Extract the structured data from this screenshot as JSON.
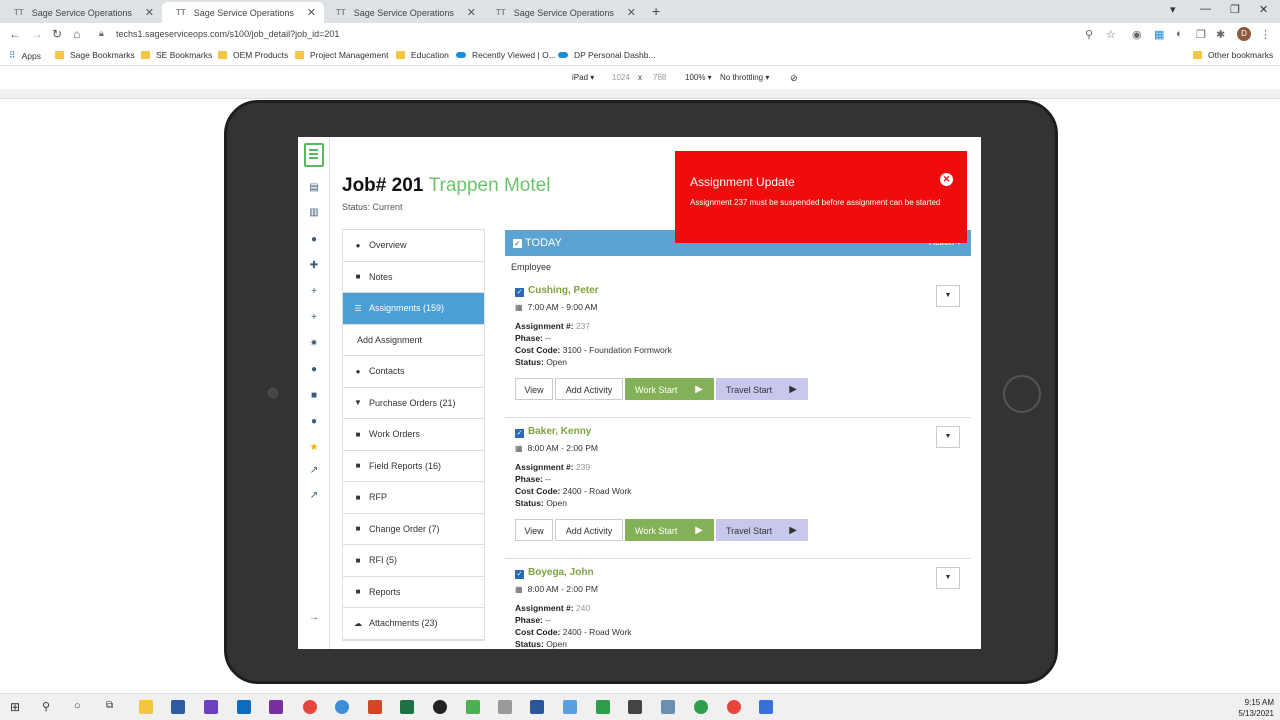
{
  "browser": {
    "tabs": [
      {
        "favicon": "TT",
        "title": "Sage Service Operations"
      },
      {
        "favicon": "TT",
        "title": "Sage Service Operations"
      },
      {
        "favicon": "TT",
        "title": "Sage Service Operations"
      },
      {
        "favicon": "TT",
        "title": "Sage Service Operations"
      }
    ],
    "url": "techs1.sageserviceops.com/s100/job_detail?job_id=201",
    "avatar_letter": "D",
    "bookmarks": [
      "Apps",
      "Sage Bookmarks",
      "SE Bookmarks",
      "OEM Products",
      "Project Management",
      "Education",
      "Recently Viewed | O...",
      "DP Personal Dashb..."
    ],
    "other_bookmarks": "Other bookmarks"
  },
  "devtools": {
    "device": "iPad ▾",
    "width": "1024",
    "x": "x",
    "height": "768",
    "zoom": "100% ▾",
    "throttle": "No throttling ▾"
  },
  "job": {
    "title": "Job# 201",
    "name": "Trappen Motel",
    "status": "Status: Current"
  },
  "menu": [
    {
      "icon": "●",
      "label": "Overview"
    },
    {
      "icon": "■",
      "label": "Notes"
    },
    {
      "icon": "☰",
      "label": "Assignments (159)"
    },
    {
      "icon": "",
      "label": "Add Assignment"
    },
    {
      "icon": "●",
      "label": "Contacts"
    },
    {
      "icon": "▼",
      "label": "Purchase Orders (21)"
    },
    {
      "icon": "■",
      "label": "Work Orders"
    },
    {
      "icon": "■",
      "label": "Field Reports (16)"
    },
    {
      "icon": "■",
      "label": "RFP"
    },
    {
      "icon": "■",
      "label": "Change Order (7)"
    },
    {
      "icon": "■",
      "label": "RFI (5)"
    },
    {
      "icon": "■",
      "label": "Reports"
    },
    {
      "icon": "☁",
      "label": "Attachments (23)"
    }
  ],
  "today": {
    "label": "TODAY",
    "action": "Action ▾",
    "employee_header": "Employee"
  },
  "labels": {
    "assignment": "Assignment #:",
    "phase": "Phase:",
    "cost_code": "Cost Code:",
    "status": "Status:",
    "view": "View",
    "add_activity": "Add Activity",
    "work_start": "Work Start",
    "travel_start": "Travel Start"
  },
  "assignments": [
    {
      "name": "Cushing, Peter",
      "time": "7:00 AM - 9:00 AM",
      "number": "237",
      "phase": "--",
      "cost_code": "3100 - Foundation Formwork",
      "status": "Open"
    },
    {
      "name": "Baker, Kenny",
      "time": "8:00 AM - 2:00 PM",
      "number": "239",
      "phase": "--",
      "cost_code": "2400 - Road Work",
      "status": "Open"
    },
    {
      "name": "Boyega, John",
      "time": "8:00 AM - 2:00 PM",
      "number": "240",
      "phase": "--",
      "cost_code": "2400 - Road Work",
      "status": "Open"
    }
  ],
  "toast": {
    "title": "Assignment Update",
    "message": "Assignment 237 must be suspended before assignment can be started"
  },
  "clock": {
    "time": "9:15 AM",
    "date": "5/13/2021"
  }
}
